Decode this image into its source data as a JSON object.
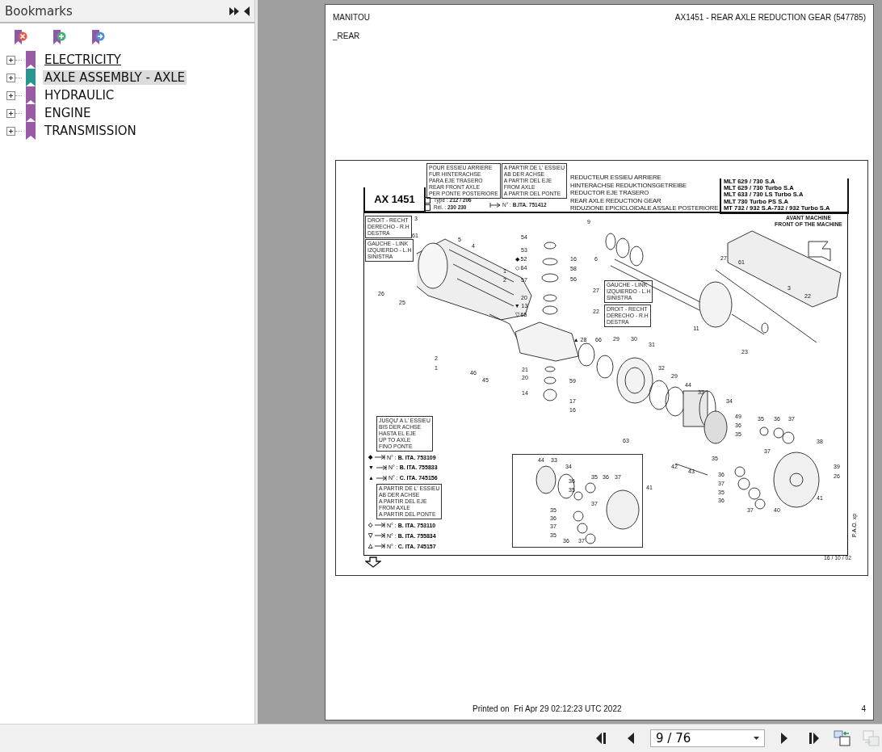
{
  "sidebar": {
    "title": "Bookmarks",
    "items": [
      {
        "label": "ELECTRICITY",
        "selected": false,
        "hovered": true,
        "expanded": false
      },
      {
        "label": "AXLE ASSEMBLY - AXLE",
        "selected": true,
        "hovered": false,
        "expanded": false
      },
      {
        "label": "HYDRAULIC",
        "selected": false,
        "hovered": false,
        "expanded": false
      },
      {
        "label": "ENGINE",
        "selected": false,
        "hovered": false,
        "expanded": false
      },
      {
        "label": "TRANSMISSION",
        "selected": false,
        "hovered": false,
        "expanded": false
      }
    ]
  },
  "page": {
    "header_left": "MANITOU",
    "header_right": "AX1451 - REAR AXLE REDUCTION GEAR (547785)",
    "section": "_REAR",
    "drawing": {
      "code": "AX 1451",
      "note_for": [
        "POUR ESSIEU ARRIERE",
        "FUR HINTERACHSE",
        "PARA EJE TRASERO",
        "REAR FRONT AXLE",
        "PER PONTE POSTERIORE"
      ],
      "note_from": [
        "A PARTIR DE L' ESSIEU",
        "AB DER ACHSE",
        "A PARTIR DEL EJE",
        "FROM AXLE",
        "A PARTIR DEL PONTE"
      ],
      "type_row": {
        "label": "Type :",
        "value": "212 / 206"
      },
      "ref_row": {
        "label": "Rél. :",
        "value": "230 230"
      },
      "serial": {
        "label": "N° :",
        "value": "B.ITA. 751412"
      },
      "titles": [
        "REDUCTEUR ESSIEU ARRIERE",
        "HINTERACHSE REDUKTIONSGETREIBE",
        "REDUCTOR EJE TRASERO",
        "REAR AXLE REDUCTION GEAR",
        "RIDUZIONE EPICICLOIDALE ASSALE POSTERIORE"
      ],
      "models": [
        "MLT 629 / 730 S.A",
        "MLT 629 / 730 Turbo S.A",
        "MLT 633 / 730 LS Turbo S.A",
        "MLT 730 Turbo PS S.A",
        "MT 732 / 932 S.A-732 / 932 Turbo S.A"
      ],
      "side_notes": [
        [
          "DROIT - RECHT",
          "DERECHO - R.H",
          "DESTRA"
        ],
        [
          "GAUCHE - LINK",
          "IZQUIERDO - L.H",
          "SINISTRA"
        ],
        [
          "GAUCHE - LINK",
          "IZQUIERDO - L.H",
          "SINISTRA"
        ],
        [
          "DROIT - RECHT",
          "DERECHO - R.H",
          "DESTRA"
        ]
      ],
      "front_note": [
        "AVANT MACHINE",
        "FRONT OF THE MACHINE"
      ],
      "legend_up_to": {
        "note": [
          "JUSQU' A L' ESSIEU",
          "BIS DER ACHSE",
          "HASTA EL EJE",
          "UP TO AXLE",
          "FINO PONTE"
        ],
        "rows": [
          {
            "symbol": "◆",
            "label": "N° :",
            "value": "B. ITA. 753109"
          },
          {
            "symbol": "▼",
            "label": "N° :",
            "value": "B. ITA. 755833"
          },
          {
            "symbol": "▲",
            "label": "N° :",
            "value": "C. ITA. 745156"
          }
        ]
      },
      "legend_from": {
        "note": [
          "A PARTIR DE L' ESSIEU",
          "AB DER ACHSE",
          "A PARTIR DEL EJE",
          "FROM AXLE",
          "A PARTIR DEL PONTE"
        ],
        "rows": [
          {
            "symbol": "◇",
            "label": "N° :",
            "value": "B. ITA. 753110"
          },
          {
            "symbol": "▽",
            "label": "N° :",
            "value": "B. ITA. 755834"
          },
          {
            "symbol": "△",
            "label": "N° :",
            "value": "C. ITA. 745157"
          }
        ]
      },
      "callouts": [
        {
          "label": "3"
        },
        {
          "label": "61"
        },
        {
          "label": "5"
        },
        {
          "label": "4"
        },
        {
          "label": "1"
        },
        {
          "label": "2"
        },
        {
          "label": "26"
        },
        {
          "label": "25"
        },
        {
          "label": "54"
        },
        {
          "label": "53"
        },
        {
          "label": "52",
          "symbol": "◆"
        },
        {
          "label": "64",
          "symbol": "◇"
        },
        {
          "label": "16"
        },
        {
          "label": "58"
        },
        {
          "label": "57"
        },
        {
          "label": "56"
        },
        {
          "label": "20"
        },
        {
          "label": "13",
          "symbol": "▼"
        },
        {
          "label": "65",
          "symbol": "▽"
        },
        {
          "label": "9"
        },
        {
          "label": "6"
        },
        {
          "label": "27"
        },
        {
          "label": "22"
        },
        {
          "label": "28",
          "symbol": "▲"
        },
        {
          "label": "66"
        },
        {
          "label": "29"
        },
        {
          "label": "30"
        },
        {
          "label": "31"
        },
        {
          "label": "11"
        },
        {
          "label": "23"
        },
        {
          "label": "2"
        },
        {
          "label": "1"
        },
        {
          "label": "46"
        },
        {
          "label": "45"
        },
        {
          "label": "21"
        },
        {
          "label": "20"
        },
        {
          "label": "59"
        },
        {
          "label": "14"
        },
        {
          "label": "17"
        },
        {
          "label": "16"
        },
        {
          "label": "32"
        },
        {
          "label": "29"
        },
        {
          "label": "44"
        },
        {
          "label": "33"
        },
        {
          "label": "34"
        },
        {
          "label": "49"
        },
        {
          "label": "36"
        },
        {
          "label": "35"
        },
        {
          "label": "35"
        },
        {
          "label": "36"
        },
        {
          "label": "37"
        },
        {
          "label": "37"
        },
        {
          "label": "38"
        },
        {
          "label": "39"
        },
        {
          "label": "26"
        },
        {
          "label": "41"
        },
        {
          "label": "40"
        },
        {
          "label": "42"
        },
        {
          "label": "43"
        },
        {
          "label": "35"
        },
        {
          "label": "36"
        },
        {
          "label": "37"
        },
        {
          "label": "35"
        },
        {
          "label": "36"
        },
        {
          "label": "37"
        },
        {
          "label": "63"
        },
        {
          "label": "44"
        },
        {
          "label": "33"
        },
        {
          "label": "34"
        },
        {
          "label": "36"
        },
        {
          "label": "35"
        },
        {
          "label": "35"
        },
        {
          "label": "36"
        },
        {
          "label": "37"
        },
        {
          "label": "37"
        },
        {
          "label": "41"
        },
        {
          "label": "35"
        },
        {
          "label": "36"
        },
        {
          "label": "37"
        },
        {
          "label": "35"
        },
        {
          "label": "36"
        },
        {
          "label": "37"
        },
        {
          "label": "27"
        },
        {
          "label": "61"
        },
        {
          "label": "3"
        },
        {
          "label": "22"
        }
      ],
      "date": "16 / 10 / 02",
      "author": "P.A.O. xp"
    },
    "footer": "Printed on  Fri Apr 29 02:12:23 UTC 2022",
    "page_number": "4"
  },
  "toolbar": {
    "page_field": "9 / 76",
    "next_view_disabled": true
  }
}
